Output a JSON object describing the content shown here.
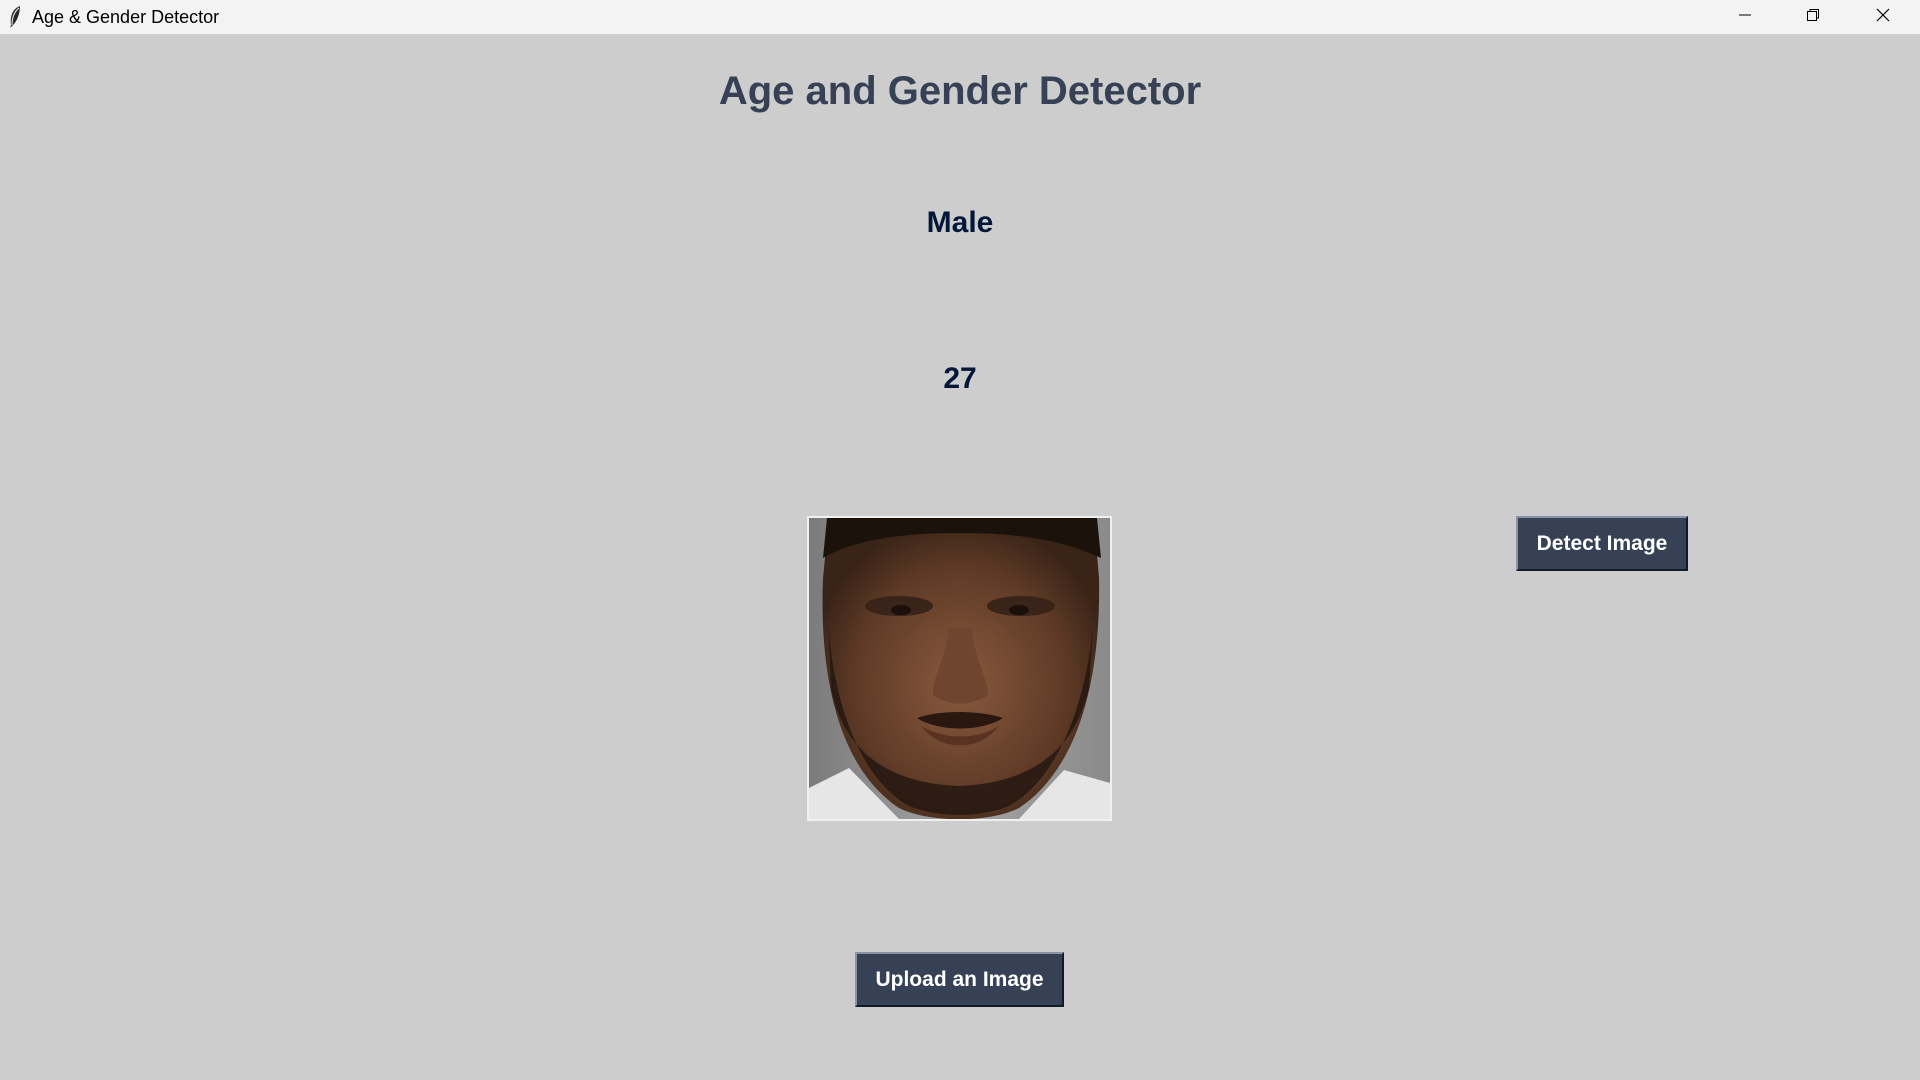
{
  "window": {
    "title": "Age & Gender Detector",
    "controls": {
      "minimize_icon": "minimize-icon",
      "maximize_icon": "restore-icon",
      "close_icon": "close-icon"
    }
  },
  "main": {
    "heading": "Age and Gender Detector",
    "gender_result": "Male",
    "age_result": "27",
    "uploaded_image_icon": "face-photo"
  },
  "buttons": {
    "detect_label": "Detect Image",
    "upload_label": "Upload an Image"
  },
  "colors": {
    "background": "#cdcdcd",
    "heading": "#364156",
    "result_text": "#011638",
    "button_bg": "#364156",
    "button_text": "#ffffff"
  }
}
